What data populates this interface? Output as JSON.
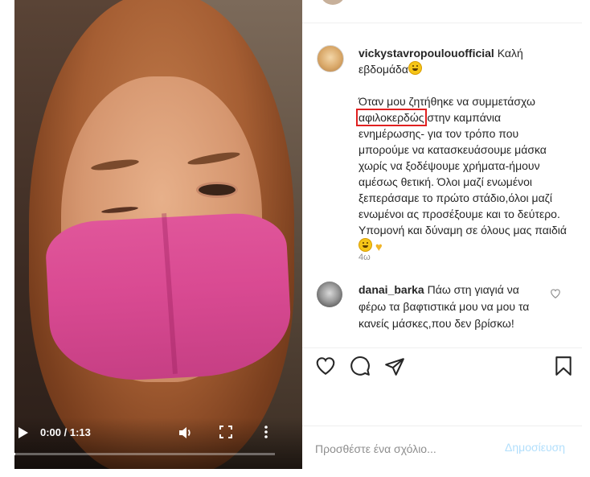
{
  "video": {
    "time": "0:00 / 1:13",
    "progress_fraction": 0.01
  },
  "post": {
    "username": "vickystavropoulouofficial",
    "caption_greeting": "Καλή εβδομάδα",
    "caption_body_1": "Όταν μου ζητήθηκε να συμμετάσχω",
    "caption_highlight": "αφιλοκερδώς",
    "caption_body_2": " στην καμπάνια ενημέρωσης- για τον τρόπο που μπορούμε να κατασκευάσουμε μάσκα χωρίς να ξοδέψουμε χρήματα-ήμουν αμέσως θετική. Όλοι μαζί ενωμένοι ξεπεράσαμε το πρώτο στάδιο,όλοι μαζί ενωμένοι ας προσέξουμε και το δεύτερο. Υπομονή και δύναμη σε όλους μας παιδιά",
    "time_ago": "4ω"
  },
  "comment": {
    "username": "danai_barka",
    "text": "Πάω στη γιαγιά να φέρω τα βαφτιστικά μου να μου τα κανείς μάσκες,που δεν βρίσκω!"
  },
  "composer": {
    "placeholder": "Προσθέστε ένα σχόλιο...",
    "post_label": "Δημοσίευση"
  },
  "colors": {
    "highlight_box": "#e02020",
    "link_disabled": "#b2dffc",
    "secondary_text": "#8e8e8e",
    "mask_pink": "#d94a92"
  },
  "icons": {
    "play": "play-icon",
    "volume": "volume-icon",
    "fullscreen": "fullscreen-icon",
    "more": "more-vertical-icon",
    "like": "heart-icon",
    "comment": "comment-bubble-icon",
    "share": "paper-plane-icon",
    "save": "bookmark-icon",
    "comment_like": "small-heart-icon"
  }
}
